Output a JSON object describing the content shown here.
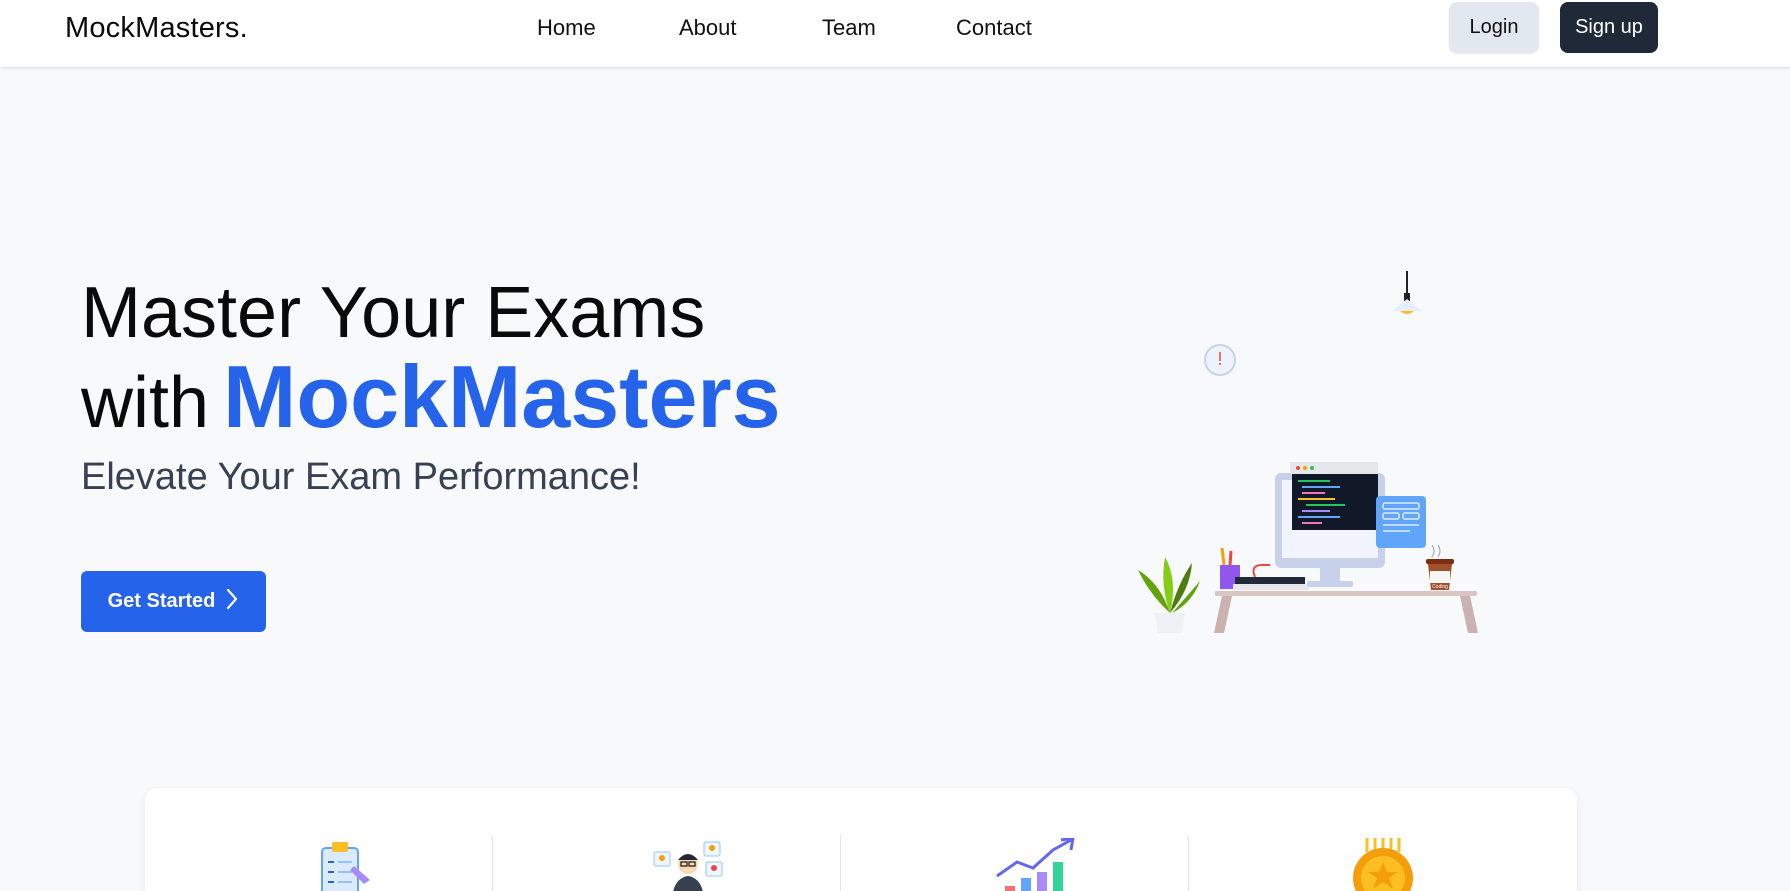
{
  "navbar": {
    "brand": "MockMasters.",
    "links": [
      "Home",
      "About",
      "Team",
      "Contact"
    ],
    "login_label": "Login",
    "signup_label": "Sign up"
  },
  "hero": {
    "title_line1": "Master Your Exams",
    "title_line2_prefix": "with",
    "title_brand": "MockMasters",
    "subtitle": "Elevate Your Exam Performance!",
    "cta_label": "Get Started",
    "illustration_mug_text": "Coding"
  },
  "features": {
    "icons": [
      "clipboard-checklist-icon",
      "team-profiles-icon",
      "growth-chart-icon",
      "gold-medal-icon"
    ]
  },
  "colors": {
    "brand_blue": "#2563eb",
    "dark_button": "#1f2937",
    "light_button": "#e2e8f0",
    "page_bg": "#f8f9fb"
  }
}
